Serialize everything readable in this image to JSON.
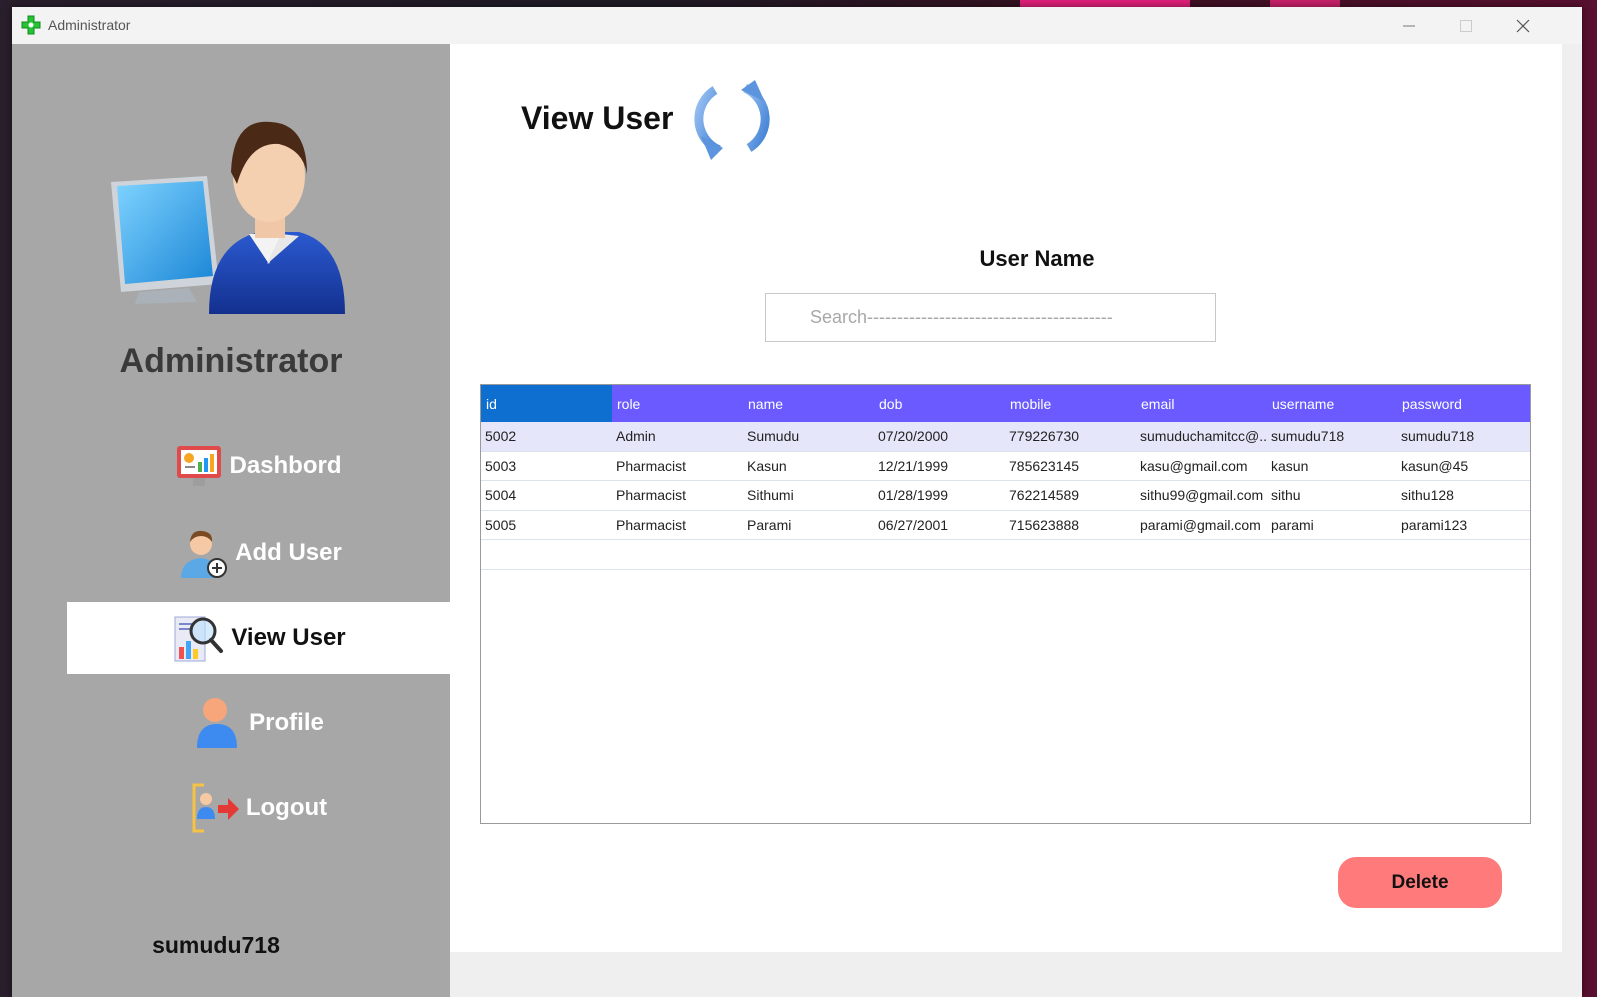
{
  "window": {
    "title": "Administrator",
    "controls": [
      "minimize-icon",
      "maximize-icon",
      "close-icon"
    ]
  },
  "sidebar": {
    "role_title": "Administrator",
    "items": [
      {
        "label": "Dashbord",
        "icon": "dashboard-icon"
      },
      {
        "label": "Add User",
        "icon": "add-user-icon"
      },
      {
        "label": "View User",
        "icon": "view-user-icon",
        "active": true
      },
      {
        "label": "Profile",
        "icon": "profile-icon"
      },
      {
        "label": "Logout",
        "icon": "logout-icon"
      }
    ],
    "username": "sumudu718"
  },
  "main": {
    "title": "View User",
    "search_label": "User Name",
    "search_placeholder": "Search-----------------------------------------",
    "delete_label": "Delete"
  },
  "table": {
    "columns": [
      "id",
      "role",
      "name",
      "dob",
      "mobile",
      "email",
      "username",
      "password"
    ],
    "rows": [
      [
        "5002",
        "Admin",
        "Sumudu",
        "07/20/2000",
        "779226730",
        "sumuduchamitcc@...",
        "sumudu718",
        "sumudu718"
      ],
      [
        "5003",
        "Pharmacist",
        "Kasun",
        "12/21/1999",
        "785623145",
        "kasu@gmail.com",
        "kasun",
        "kasun@45"
      ],
      [
        "5004",
        "Pharmacist",
        "Sithumi",
        "01/28/1999",
        "762214589",
        "sithu99@gmail.com",
        "sithu",
        "sithu128"
      ],
      [
        "5005",
        "Pharmacist",
        "Parami",
        "06/27/2001",
        "715623888",
        "parami@gmail.com",
        "parami",
        "parami123"
      ]
    ]
  },
  "colors": {
    "sidebar_bg": "#a7a7a7",
    "header_bg": "#6a5aff",
    "header_selected": "#0f6fd0",
    "selected_row": "#e6e6fa",
    "delete_button": "#ff7b7b"
  }
}
